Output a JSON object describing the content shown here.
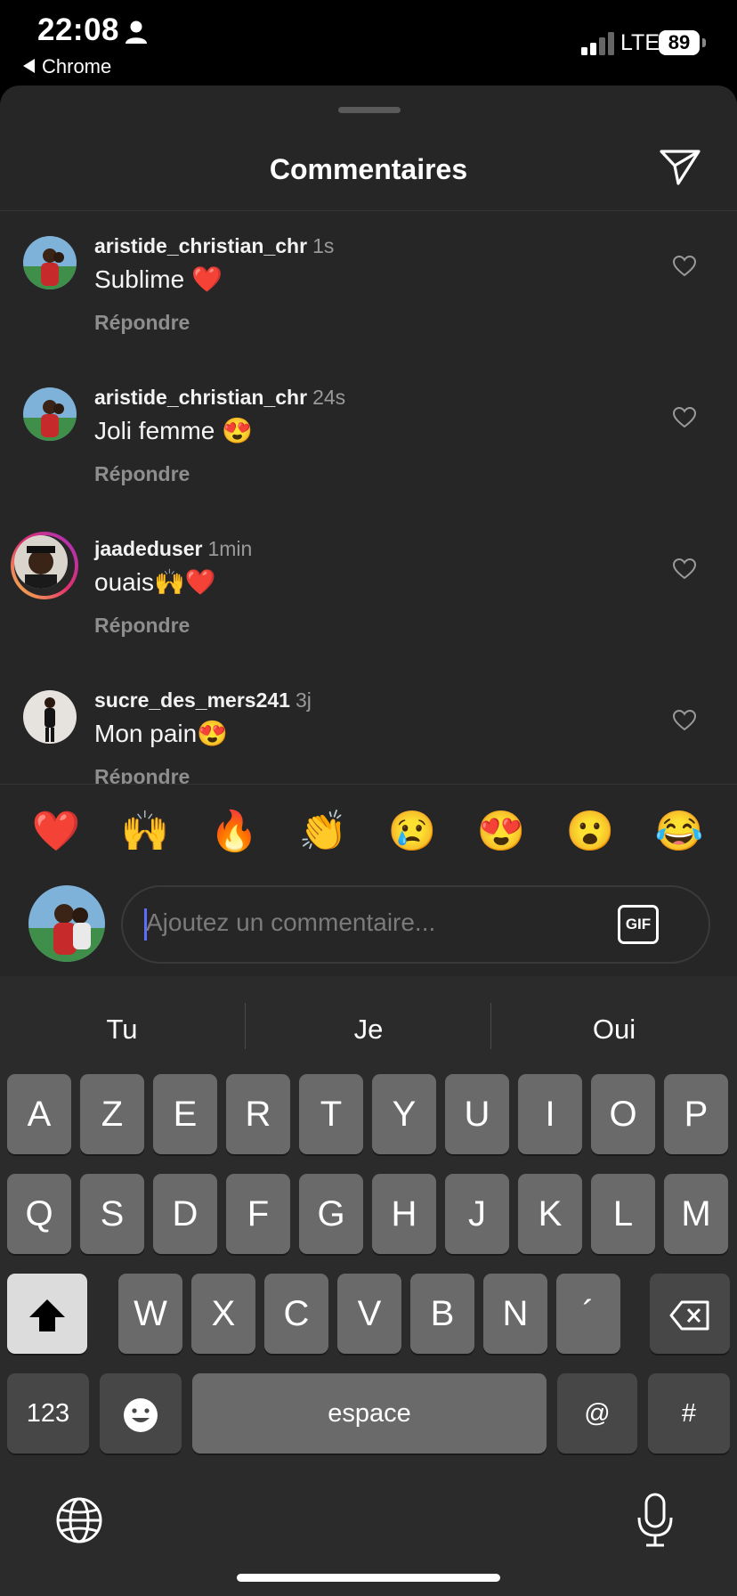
{
  "status_bar": {
    "time": "22:08",
    "back_app": "Chrome",
    "network": "LTE",
    "battery": "89"
  },
  "header": {
    "title": "Commentaires"
  },
  "comments": [
    {
      "username": "aristide_christian_chr",
      "time": "1s",
      "text": "Sublime ❤️",
      "reply": "Répondre"
    },
    {
      "username": "aristide_christian_chr",
      "time": "24s",
      "text": "Joli femme 😍",
      "reply": "Répondre"
    },
    {
      "username": "jaadeduser",
      "time": "1min",
      "text": "ouais🙌❤️",
      "reply": "Répondre"
    },
    {
      "username": "sucre_des_mers241",
      "time": "3j",
      "text": "Mon pain😍",
      "reply": "Répondre"
    }
  ],
  "quick_emojis": [
    "❤️",
    "🙌",
    "🔥",
    "👏",
    "😢",
    "😍",
    "😮",
    "😂"
  ],
  "composer": {
    "placeholder": "Ajoutez un commentaire...",
    "gif_label": "GIF"
  },
  "keyboard": {
    "suggestions": [
      "Tu",
      "Je",
      "Oui"
    ],
    "row1": [
      "A",
      "Z",
      "E",
      "R",
      "T",
      "Y",
      "U",
      "I",
      "O",
      "P"
    ],
    "row2": [
      "Q",
      "S",
      "D",
      "F",
      "G",
      "H",
      "J",
      "K",
      "L",
      "M"
    ],
    "row3": [
      "W",
      "X",
      "C",
      "V",
      "B",
      "N",
      "´"
    ],
    "numbers_key": "123",
    "space_key": "espace",
    "at_key": "@",
    "hash_key": "#"
  }
}
